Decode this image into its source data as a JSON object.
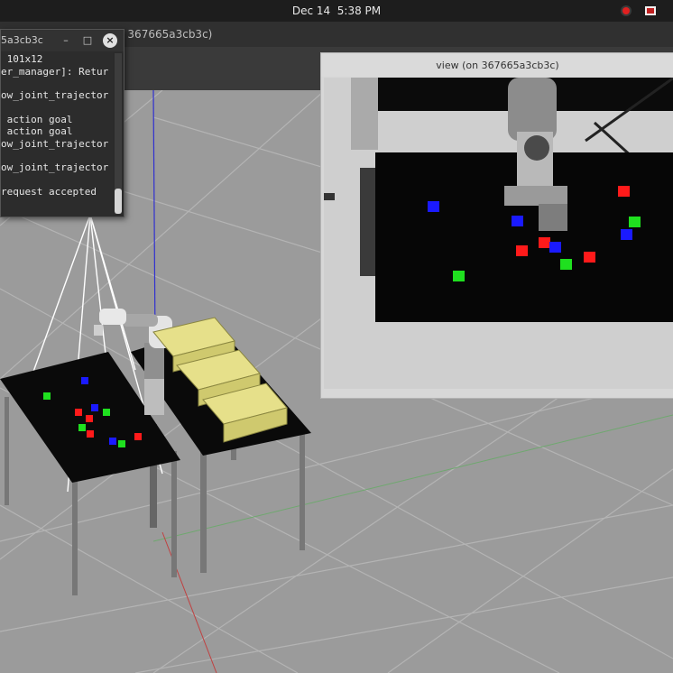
{
  "topbar": {
    "date": "Dec 14",
    "time": "5:38 PM",
    "icons": [
      "record-icon",
      "app-indicator-icon"
    ]
  },
  "gazebo": {
    "title_fragment": "n 367665a3cb3c)"
  },
  "terminal": {
    "title_fragment": "5a3cb3c",
    "lines": [
      " 101x12",
      "er_manager]: Retur",
      "",
      "ow_joint_trajector",
      "",
      " action goal",
      " action goal",
      "ow_joint_trajector",
      "",
      "ow_joint_trajector",
      "",
      "request accepted"
    ]
  },
  "view_window": {
    "title": "view (on 367665a3cb3c)"
  },
  "colors": {
    "cube_red": "#ff1a1a",
    "cube_green": "#1fe01f",
    "cube_blue": "#1a1aff",
    "bin_yellow": "#e6e08a"
  }
}
